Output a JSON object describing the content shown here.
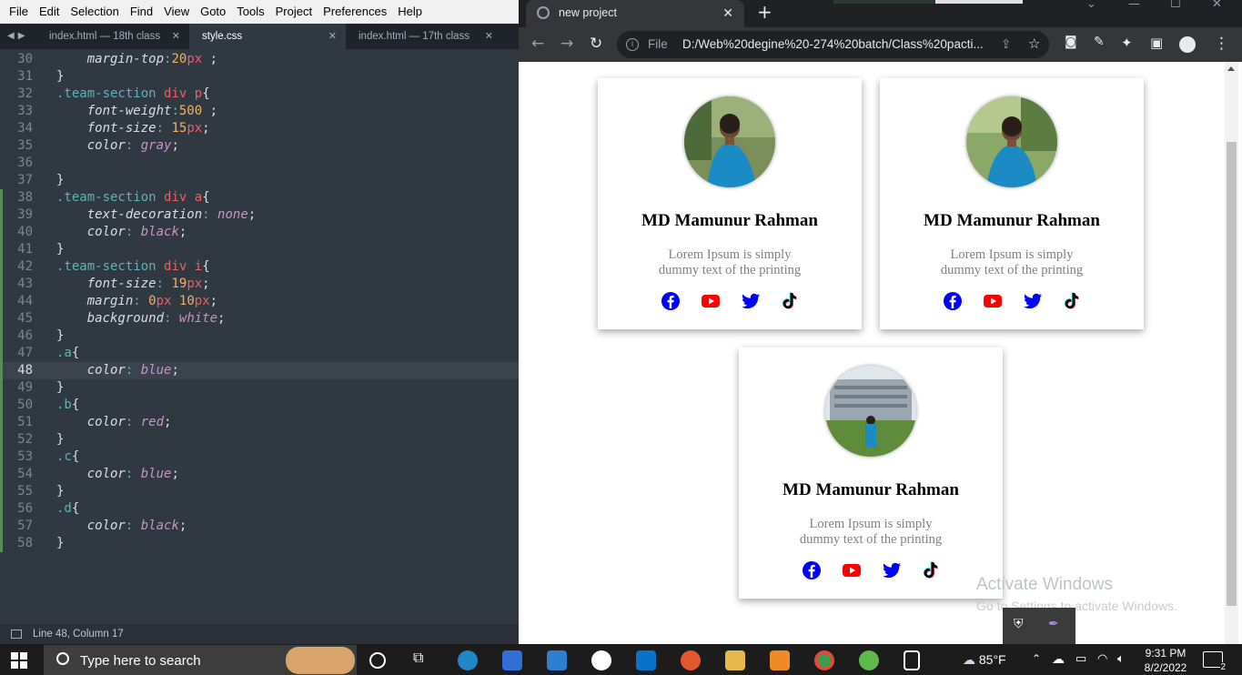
{
  "editor": {
    "menu": [
      "File",
      "Edit",
      "Selection",
      "Find",
      "View",
      "Goto",
      "Tools",
      "Project",
      "Preferences",
      "Help"
    ],
    "tabs": [
      {
        "label": "index.html — 18th class",
        "active": false
      },
      {
        "label": "style.css",
        "active": true
      },
      {
        "label": "index.html — 17th class",
        "active": false
      }
    ],
    "lines": [
      {
        "n": "30",
        "html": "    <span class='prop'>margin-top</span><span class='colon'>:</span><span class='num'>20</span><span class='unit'>px</span> <span class='semi'>;</span>"
      },
      {
        "n": "31",
        "html": "<span class='br'>}</span>"
      },
      {
        "n": "32",
        "html": "<span class='sel'>.team-section</span> <span class='cls'>div</span> <span class='cls'>p</span><span class='br'>{</span>"
      },
      {
        "n": "33",
        "html": "    <span class='prop'>font-weight</span><span class='colon'>:</span><span class='num'>500</span> <span class='semi'>;</span>"
      },
      {
        "n": "34",
        "html": "    <span class='prop'>font-size</span><span class='colon'>:</span> <span class='num'>15</span><span class='unit'>px</span><span class='semi'>;</span>"
      },
      {
        "n": "35",
        "html": "    <span class='prop'>color</span><span class='colon'>:</span> <span class='val'>gray</span><span class='semi'>;</span>"
      },
      {
        "n": "36",
        "html": ""
      },
      {
        "n": "37",
        "html": "<span class='br'>}</span>"
      },
      {
        "n": "38",
        "html": "<span class='sel'>.team-section</span> <span class='cls'>div</span> <span class='cls'>a</span><span class='br'>{</span>",
        "mark": true
      },
      {
        "n": "39",
        "html": "    <span class='prop'>text-decoration</span><span class='colon'>:</span> <span class='val'>none</span><span class='semi'>;</span>",
        "mark": true
      },
      {
        "n": "40",
        "html": "    <span class='prop'>color</span><span class='colon'>:</span> <span class='val'>black</span><span class='semi'>;</span>",
        "mark": true
      },
      {
        "n": "41",
        "html": "<span class='br'>}</span>",
        "mark": true
      },
      {
        "n": "42",
        "html": "<span class='sel'>.team-section</span> <span class='cls'>div</span> <span class='cls'>i</span><span class='br'>{</span>",
        "mark": true
      },
      {
        "n": "43",
        "html": "    <span class='prop'>font-size</span><span class='colon'>:</span> <span class='num'>19</span><span class='unit'>px</span><span class='semi'>;</span>",
        "mark": true
      },
      {
        "n": "44",
        "html": "    <span class='prop'>margin</span><span class='colon'>:</span> <span class='num'>0</span><span class='unit'>px</span> <span class='num'>10</span><span class='unit'>px</span><span class='semi'>;</span>",
        "mark": true
      },
      {
        "n": "45",
        "html": "    <span class='prop'>background</span><span class='colon'>:</span> <span class='val'>white</span><span class='semi'>;</span>",
        "mark": true
      },
      {
        "n": "46",
        "html": "<span class='br'>}</span>",
        "mark": true
      },
      {
        "n": "47",
        "html": "<span class='sel'>.a</span><span class='br'>{</span>",
        "mark": true
      },
      {
        "n": "48",
        "html": "    <span class='prop'>color</span><span class='colon'>:</span> <span class='val'>blue</span><span class='semi'>;</span>",
        "mark": true,
        "cur": true
      },
      {
        "n": "49",
        "html": "<span class='br'>}</span>",
        "mark": true
      },
      {
        "n": "50",
        "html": "<span class='sel'>.b</span><span class='br'>{</span>",
        "mark": true
      },
      {
        "n": "51",
        "html": "    <span class='prop'>color</span><span class='colon'>:</span> <span class='val'>red</span><span class='semi'>;</span>",
        "mark": true
      },
      {
        "n": "52",
        "html": "<span class='br'>}</span>",
        "mark": true
      },
      {
        "n": "53",
        "html": "<span class='sel'>.c</span><span class='br'>{</span>",
        "mark": true
      },
      {
        "n": "54",
        "html": "    <span class='prop'>color</span><span class='colon'>:</span> <span class='val'>blue</span><span class='semi'>;</span>",
        "mark": true
      },
      {
        "n": "55",
        "html": "<span class='br'>}</span>",
        "mark": true
      },
      {
        "n": "56",
        "html": "<span class='sel'>.d</span><span class='br'>{</span>",
        "mark": true
      },
      {
        "n": "57",
        "html": "    <span class='prop'>color</span><span class='colon'>:</span> <span class='val'>black</span><span class='semi'>;</span>",
        "mark": true
      },
      {
        "n": "58",
        "html": "<span class='br'>}</span>",
        "mark": true
      }
    ],
    "status": "Line 48, Column 17"
  },
  "browser": {
    "tab_title": "new project",
    "address_prefix": "File",
    "address": "D:/Web%20degine%20-274%20batch/Class%20pacti...",
    "cards": [
      {
        "name": "MD Mamunur Rahman",
        "desc": "Lorem Ipsum is simply dummy text of the printing"
      },
      {
        "name": "MD Mamunur Rahman",
        "desc": "Lorem Ipsum is simply dummy text of the printing"
      },
      {
        "name": "MD Mamunur Rahman",
        "desc": "Lorem Ipsum is simply dummy text of the printing"
      }
    ],
    "social_icons": [
      {
        "icon": "facebook-icon",
        "color": "#0000ff"
      },
      {
        "icon": "youtube-icon",
        "color": "#ff0000"
      },
      {
        "icon": "twitter-icon",
        "color": "#0000ff"
      },
      {
        "icon": "tiktok-icon",
        "color": "#000000"
      }
    ],
    "watermark_title": "Activate Windows",
    "watermark_sub": "Go to Settings to activate Windows."
  },
  "taskbar": {
    "search_placeholder": "Type here to search",
    "weather": "85°F",
    "time": "9:31 PM",
    "date": "8/2/2022",
    "notification_count": "2"
  }
}
